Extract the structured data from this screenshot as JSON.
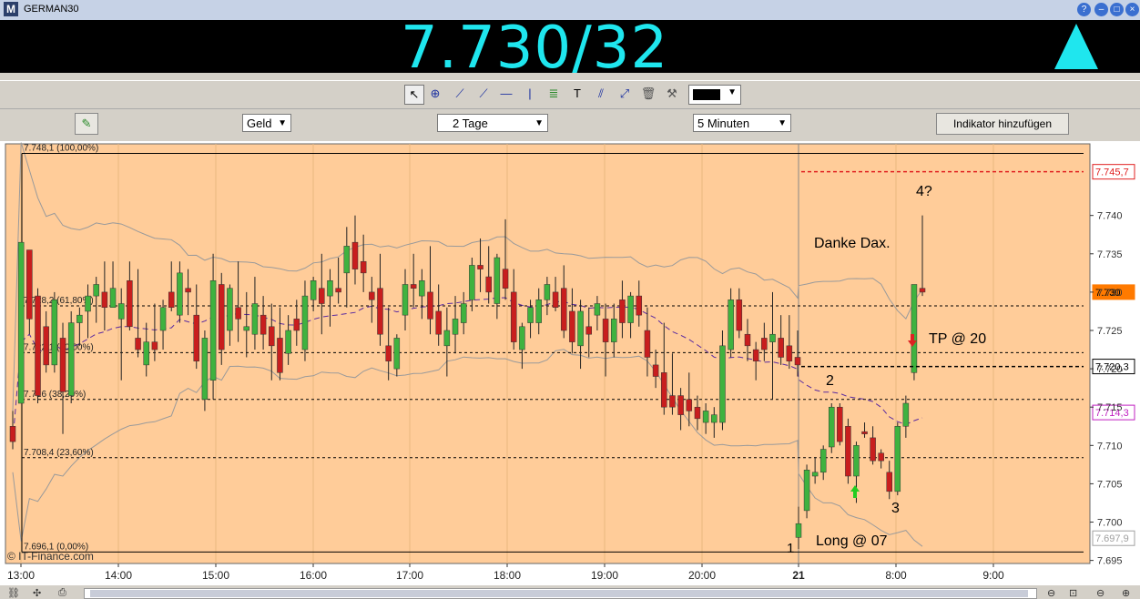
{
  "window": {
    "title": "GERMAN30",
    "logo": "M",
    "icons": [
      "help-icon",
      "minimize-icon",
      "maximize-icon",
      "close-icon"
    ]
  },
  "quote": {
    "price": "7.730/32",
    "color": "#1fe6ee",
    "direction_icon": "up-arrow-icon"
  },
  "toolbar": {
    "tools": [
      "cursor-icon",
      "zoom-icon",
      "trendline-icon",
      "ray-icon",
      "hline-icon",
      "vline-icon",
      "fibonacci-icon",
      "text-icon",
      "channel-icon",
      "expand-icon",
      "trash-icon",
      "tools-icon"
    ],
    "line_color": "#000000"
  },
  "controls": {
    "draw_tool_icon": "pencil-icon",
    "price_type": "Geld",
    "period": "2 Tage",
    "interval": "5 Minuten",
    "add_indicator": "Indikator hinzufügen"
  },
  "chart_data": {
    "type": "candlestick",
    "y_ticks": [
      "7.740",
      "7.735",
      "7.730",
      "7.725",
      "7.720",
      "7.715",
      "7.710",
      "7.705",
      "7.700",
      "7.695"
    ],
    "ylim": [
      7.6946,
      7.7497
    ],
    "x_ticks": [
      "13:00",
      "14:00",
      "15:00",
      "16:00",
      "17:00",
      "18:00",
      "19:00",
      "20:00",
      "21",
      "8:00",
      "9:00"
    ],
    "fib_levels": [
      {
        "label": "7.748,1 (100,00%)",
        "value": 7.7481
      },
      {
        "label": "7.728,2 (61,80%)",
        "value": 7.7282
      },
      {
        "label": "7.722,1 (50,00%)",
        "value": 7.7221
      },
      {
        "label": "7.716 (38,20%)",
        "value": 7.716
      },
      {
        "label": "7.708,4 (23,60%)",
        "value": 7.7084
      },
      {
        "label": "7.696,1 (0,00%)",
        "value": 7.6961
      }
    ],
    "price_tags": [
      {
        "label": "7.745,7",
        "value": 7.7457,
        "color": "#e02020"
      },
      {
        "label": "7.730",
        "value": 7.73,
        "color": "#ff7a00"
      },
      {
        "label": "7.720,3",
        "value": 7.7203,
        "color": "#000000"
      },
      {
        "label": "7.714,3",
        "value": 7.7143,
        "color": "#c020c0"
      },
      {
        "label": "7.697,9",
        "value": 7.6979,
        "color": "#a0a0a0"
      }
    ],
    "annotations": [
      "Danke Dax.",
      "4?",
      "TP @ 20",
      "2",
      "3",
      "1",
      "Long @ 07"
    ],
    "watermark": "© IT-Finance.com",
    "candles": [
      [
        7.7125,
        7.7145,
        7.7095,
        7.7105
      ],
      [
        7.7155,
        7.7365,
        7.7155,
        7.7365
      ],
      [
        7.7355,
        7.735,
        7.7245,
        7.7265
      ],
      [
        7.7295,
        7.7305,
        7.7155,
        7.7165
      ],
      [
        7.7255,
        7.7275,
        7.7195,
        7.7205
      ],
      [
        7.7205,
        7.73,
        7.7195,
        7.729
      ],
      [
        7.724,
        7.726,
        7.7115,
        7.717
      ],
      [
        7.7165,
        7.7275,
        7.7155,
        7.726
      ],
      [
        7.726,
        7.728,
        7.723,
        7.727
      ],
      [
        7.7275,
        7.731,
        7.724,
        7.7295
      ],
      [
        7.7295,
        7.732,
        7.726,
        7.731
      ],
      [
        7.73,
        7.734,
        7.725,
        7.728
      ],
      [
        7.728,
        7.734,
        7.728,
        7.7305
      ],
      [
        7.7265,
        7.7305,
        7.7185,
        7.7285
      ],
      [
        7.7315,
        7.734,
        7.725,
        7.7255
      ],
      [
        7.724,
        7.733,
        7.7215,
        7.7225
      ],
      [
        7.7205,
        7.726,
        7.719,
        7.7235
      ],
      [
        7.7235,
        7.7285,
        7.721,
        7.7225
      ],
      [
        7.725,
        7.729,
        7.7225,
        7.728
      ],
      [
        7.73,
        7.734,
        7.7275,
        7.728
      ],
      [
        7.727,
        7.734,
        7.726,
        7.7325
      ],
      [
        7.7305,
        7.733,
        7.727,
        7.73
      ],
      [
        7.727,
        7.731,
        7.72,
        7.721
      ],
      [
        7.716,
        7.725,
        7.7145,
        7.724
      ],
      [
        7.7185,
        7.735,
        7.716,
        7.7315
      ],
      [
        7.731,
        7.7325,
        7.7205,
        7.7225
      ],
      [
        7.725,
        7.731,
        7.723,
        7.7305
      ],
      [
        7.728,
        7.734,
        7.7235,
        7.7265
      ],
      [
        7.725,
        7.73,
        7.7215,
        7.7255
      ],
      [
        7.7245,
        7.732,
        7.7225,
        7.7285
      ],
      [
        7.727,
        7.7295,
        7.7225,
        7.7245
      ],
      [
        7.7255,
        7.7285,
        7.7185,
        7.723
      ],
      [
        7.724,
        7.728,
        7.7185,
        7.7195
      ],
      [
        7.722,
        7.727,
        7.7205,
        7.725
      ],
      [
        7.7265,
        7.729,
        7.723,
        7.725
      ],
      [
        7.7225,
        7.7315,
        7.721,
        7.7295
      ],
      [
        7.729,
        7.732,
        7.7275,
        7.7315
      ],
      [
        7.7305,
        7.735,
        7.7245,
        7.7285
      ],
      [
        7.7295,
        7.733,
        7.7255,
        7.7315
      ],
      [
        7.7305,
        7.7345,
        7.7285,
        7.73
      ],
      [
        7.7325,
        7.7385,
        7.728,
        7.736
      ],
      [
        7.7365,
        7.74,
        7.731,
        7.733
      ],
      [
        7.734,
        7.7375,
        7.73,
        7.7325
      ],
      [
        7.73,
        7.732,
        7.726,
        7.729
      ],
      [
        7.7305,
        7.735,
        7.723,
        7.7245
      ],
      [
        7.723,
        7.728,
        7.7185,
        7.721
      ],
      [
        7.72,
        7.7245,
        7.719,
        7.724
      ],
      [
        7.727,
        7.733,
        7.725,
        7.731
      ],
      [
        7.731,
        7.735,
        7.728,
        7.7305
      ],
      [
        7.7295,
        7.733,
        7.7265,
        7.7315
      ],
      [
        7.73,
        7.736,
        7.7245,
        7.7265
      ],
      [
        7.7275,
        7.731,
        7.723,
        7.7245
      ],
      [
        7.723,
        7.728,
        7.719,
        7.725
      ],
      [
        7.7245,
        7.7295,
        7.722,
        7.7265
      ],
      [
        7.726,
        7.73,
        7.7245,
        7.7285
      ],
      [
        7.729,
        7.7345,
        7.7275,
        7.7335
      ],
      [
        7.7335,
        7.737,
        7.73,
        7.733
      ],
      [
        7.732,
        7.736,
        7.7285,
        7.73
      ],
      [
        7.7285,
        7.735,
        7.7265,
        7.7345
      ],
      [
        7.733,
        7.7395,
        7.729,
        7.7305
      ],
      [
        7.73,
        7.733,
        7.7225,
        7.7235
      ],
      [
        7.7225,
        7.726,
        7.72,
        7.7255
      ],
      [
        7.726,
        7.729,
        7.724,
        7.728
      ],
      [
        7.726,
        7.7305,
        7.7245,
        7.729
      ],
      [
        7.729,
        7.732,
        7.727,
        7.731
      ],
      [
        7.73,
        7.732,
        7.7275,
        7.728
      ],
      [
        7.7305,
        7.7335,
        7.724,
        7.725
      ],
      [
        7.7275,
        7.7305,
        7.722,
        7.7235
      ],
      [
        7.723,
        7.729,
        7.72,
        7.7275
      ],
      [
        7.7255,
        7.728,
        7.7215,
        7.7245
      ],
      [
        7.727,
        7.7295,
        7.725,
        7.7285
      ],
      [
        7.7265,
        7.7285,
        7.719,
        7.7235
      ],
      [
        7.7235,
        7.7285,
        7.7215,
        7.7265
      ],
      [
        7.729,
        7.7315,
        7.724,
        7.726
      ],
      [
        7.726,
        7.73,
        7.724,
        7.7295
      ],
      [
        7.7295,
        7.7315,
        7.7255,
        7.727
      ],
      [
        7.725,
        7.728,
        7.719,
        7.7215
      ],
      [
        7.7205,
        7.7225,
        7.7175,
        7.719
      ],
      [
        7.7195,
        7.726,
        7.714,
        7.715
      ],
      [
        7.7165,
        7.722,
        7.714,
        7.715
      ],
      [
        7.7165,
        7.7175,
        7.712,
        7.714
      ],
      [
        7.716,
        7.7195,
        7.7125,
        7.7145
      ],
      [
        7.715,
        7.7165,
        7.712,
        7.7135
      ],
      [
        7.713,
        7.7155,
        7.7115,
        7.7145
      ],
      [
        7.713,
        7.715,
        7.711,
        7.714
      ],
      [
        7.713,
        7.725,
        7.712,
        7.723
      ],
      [
        7.7225,
        7.7305,
        7.7215,
        7.729
      ],
      [
        7.729,
        7.7305,
        7.724,
        7.725
      ],
      [
        7.7245,
        7.7265,
        7.721,
        7.723
      ],
      [
        7.7225,
        7.7235,
        7.7185,
        7.721
      ],
      [
        7.724,
        7.726,
        7.721,
        7.7225
      ],
      [
        7.7235,
        7.73,
        7.716,
        7.7245
      ],
      [
        7.724,
        7.727,
        7.7205,
        7.7215
      ],
      [
        7.723,
        7.727,
        7.72,
        7.721
      ],
      [
        7.7215,
        7.725,
        7.719,
        7.7205
      ],
      [
        7.698,
        7.702,
        7.6965,
        7.6998
      ],
      [
        7.7015,
        7.7075,
        7.7005,
        7.7068
      ],
      [
        7.706,
        7.7085,
        7.705,
        7.7065
      ],
      [
        7.7065,
        7.71,
        7.7055,
        7.7095
      ],
      [
        7.7098,
        7.7155,
        7.709,
        7.715
      ],
      [
        7.715,
        7.7155,
        7.71,
        7.7105
      ],
      [
        7.7125,
        7.7135,
        7.705,
        7.706
      ],
      [
        7.706,
        7.7105,
        7.7025,
        7.71
      ],
      [
        7.7118,
        7.713,
        7.711,
        7.7115
      ],
      [
        7.711,
        7.7125,
        7.7075,
        7.708
      ],
      [
        7.709,
        7.7095,
        7.707,
        7.708
      ],
      [
        7.7065,
        7.708,
        7.703,
        7.704
      ],
      [
        7.704,
        7.713,
        7.7035,
        7.7125
      ],
      [
        7.7125,
        7.7165,
        7.711,
        7.7155
      ],
      [
        7.7195,
        7.731,
        7.7185,
        7.731
      ],
      [
        7.7305,
        7.74,
        7.7295,
        7.73
      ]
    ]
  }
}
